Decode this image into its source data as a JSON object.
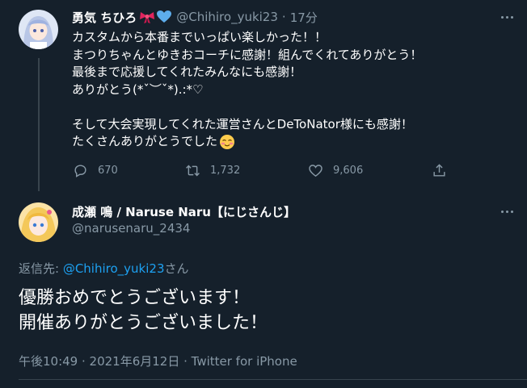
{
  "tweet1": {
    "display_name": "勇気 ちひろ",
    "handle": "@Chihiro_yuki23",
    "time_sep": "·",
    "time": "17分",
    "lines": [
      "カスタムから本番までいっぱい楽しかった！！",
      "まつりちゃんとゆきおコーチに感謝！組んでくれてありがとう！",
      "最後まで応援してくれたみんなにも感謝！",
      "ありがとう(*ˇ︶ˇ*).:*♡",
      "",
      "そして大会実現してくれた運営さんとDeToNator様にも感謝！",
      "たくさんありがとうでした"
    ],
    "reply_count": "670",
    "retweet_count": "1,732",
    "like_count": "9,606"
  },
  "tweet2": {
    "display_name": "成瀬 鳴 / Naruse Naru【にじさんじ】",
    "handle": "@narusenaru_2434",
    "reply_prefix": "返信先: ",
    "reply_to": "@Chihiro_yuki23",
    "reply_suffix": "さん",
    "lines": [
      "優勝おめでとうございます！",
      "開催ありがとうございました！"
    ],
    "timestamp": "午後10:49 · 2021年6月12日 · Twitter for iPhone"
  },
  "colors": {
    "background": "#15202b",
    "muted": "#8899a6",
    "link": "#1da1f2",
    "divider": "#38444d"
  },
  "icons": [
    "more-icon",
    "ribbon-emoji",
    "blue-heart-emoji",
    "blush-emoji",
    "reply-icon",
    "retweet-icon",
    "like-icon",
    "share-icon"
  ]
}
